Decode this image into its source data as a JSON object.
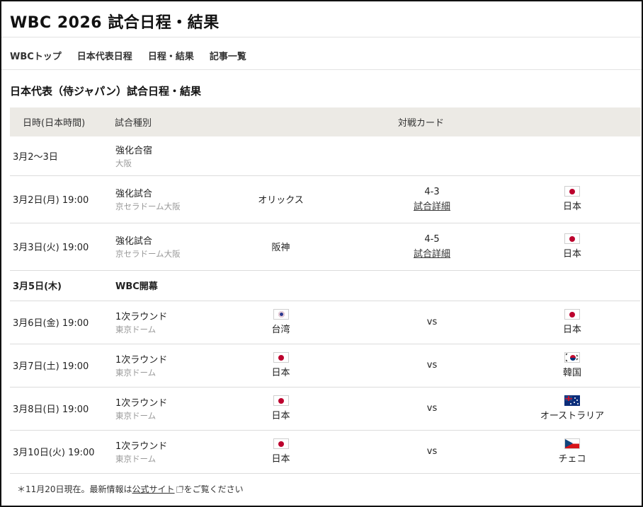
{
  "page": {
    "title": "WBC 2026 試合日程・結果"
  },
  "nav": [
    {
      "label": "WBCトップ"
    },
    {
      "label": "日本代表日程"
    },
    {
      "label": "日程・結果"
    },
    {
      "label": "記事一覧"
    }
  ],
  "section_title": "日本代表（侍ジャパン）試合日程・結果",
  "table": {
    "headers": {
      "date": "日時(日本時間)",
      "type": "試合種別",
      "matchup": "対戦カード"
    },
    "rows": [
      {
        "date": "3月2〜3日",
        "type": "強化合宿",
        "venue": "大阪"
      },
      {
        "date": "3月2日(月) 19:00",
        "type": "強化試合",
        "venue": "京セラドーム大阪",
        "home": "オリックス",
        "score": "4-3",
        "detail": "試合詳細",
        "away": "日本",
        "away_flag": "japan-flag-icon"
      },
      {
        "date": "3月3日(火) 19:00",
        "type": "強化試合",
        "venue": "京セラドーム大阪",
        "home": "阪神",
        "score": "4-5",
        "detail": "試合詳細",
        "away": "日本",
        "away_flag": "japan-flag-icon"
      },
      {
        "date": "3月5日(木)",
        "type": "WBC開幕"
      },
      {
        "date": "3月6日(金) 19:00",
        "type": "1次ラウンド",
        "venue": "東京ドーム",
        "home": "台湾",
        "home_flag": "taiwan-flag-icon",
        "score": "vs",
        "away": "日本",
        "away_flag": "japan-flag-icon"
      },
      {
        "date": "3月7日(土) 19:00",
        "type": "1次ラウンド",
        "venue": "東京ドーム",
        "home": "日本",
        "home_flag": "japan-flag-icon",
        "score": "vs",
        "away": "韓国",
        "away_flag": "korea-flag-icon"
      },
      {
        "date": "3月8日(日) 19:00",
        "type": "1次ラウンド",
        "venue": "東京ドーム",
        "home": "日本",
        "home_flag": "japan-flag-icon",
        "score": "vs",
        "away": "オーストラリア",
        "away_flag": "australia-flag-icon"
      },
      {
        "date": "3月10日(火) 19:00",
        "type": "1次ラウンド",
        "venue": "東京ドーム",
        "home": "日本",
        "home_flag": "japan-flag-icon",
        "score": "vs",
        "away": "チェコ",
        "away_flag": "czech-flag-icon"
      }
    ]
  },
  "footer": {
    "prefix": "＊11月20日現在。最新情報は",
    "link": "公式サイト",
    "suffix": "をご覧ください",
    "link_icon": "external-link-icon"
  }
}
